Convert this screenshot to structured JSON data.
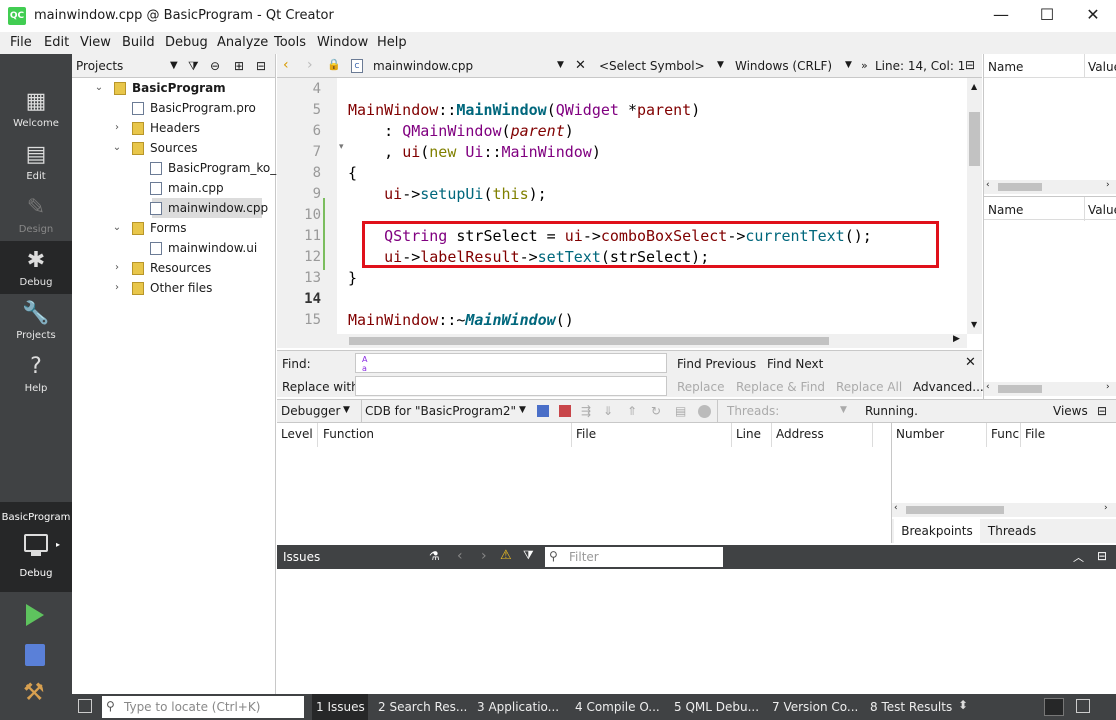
{
  "window": {
    "title": "mainwindow.cpp @ BasicProgram - Qt Creator",
    "app_icon": "QC",
    "minimize": "—",
    "maximize": "☐",
    "close": "✕"
  },
  "menu": [
    "File",
    "Edit",
    "View",
    "Build",
    "Debug",
    "Analyze",
    "Tools",
    "Window",
    "Help"
  ],
  "modes": [
    {
      "label": "Welcome",
      "icon": "▦"
    },
    {
      "label": "Edit",
      "icon": "▤"
    },
    {
      "label": "Design",
      "icon": "✎"
    },
    {
      "label": "Debug",
      "icon": "✱"
    },
    {
      "label": "Projects",
      "icon": "🔧"
    },
    {
      "label": "Help",
      "icon": "?"
    }
  ],
  "kit": {
    "project": "BasicProgram",
    "config": "Debug"
  },
  "projects_pane": {
    "title": "Projects",
    "tree": [
      {
        "label": "BasicProgram",
        "depth": 0,
        "arrow": "⌄",
        "bold": true
      },
      {
        "label": "BasicProgram.pro",
        "depth": 1,
        "arrow": ""
      },
      {
        "label": "Headers",
        "depth": 1,
        "arrow": "›"
      },
      {
        "label": "Sources",
        "depth": 1,
        "arrow": "⌄"
      },
      {
        "label": "BasicProgram_ko_KR.ts",
        "depth": 2,
        "arrow": ""
      },
      {
        "label": "main.cpp",
        "depth": 2,
        "arrow": ""
      },
      {
        "label": "mainwindow.cpp",
        "depth": 2,
        "arrow": "",
        "selected": true
      },
      {
        "label": "Forms",
        "depth": 1,
        "arrow": "⌄"
      },
      {
        "label": "mainwindow.ui",
        "depth": 2,
        "arrow": ""
      },
      {
        "label": "Resources",
        "depth": 1,
        "arrow": "›"
      },
      {
        "label": "Other files",
        "depth": 1,
        "arrow": "›"
      }
    ]
  },
  "editor": {
    "file": "mainwindow.cpp",
    "symbol": "<Select Symbol>",
    "encoding": "Windows (CRLF)",
    "position": "Line: 14, Col: 1",
    "lines": [
      "4",
      "5",
      "6",
      "7",
      "8",
      "9",
      "10",
      "11",
      "12",
      "13",
      "14",
      "15"
    ]
  },
  "find": {
    "find_label": "Find:",
    "replace_label": "Replace with:",
    "find_prev": "Find Previous",
    "find_next": "Find Next",
    "replace": "Replace",
    "replace_find": "Replace & Find",
    "replace_all": "Replace All",
    "advanced": "Advanced..."
  },
  "locals": {
    "name": "Name",
    "value": "Value"
  },
  "debugger": {
    "selector": "Debugger",
    "engine": "CDB for \"BasicProgram2\"",
    "threads": "Threads:",
    "status": "Running.",
    "views": "Views"
  },
  "stack_cols": [
    "Level",
    "Function",
    "File",
    "Line",
    "Address"
  ],
  "bp_cols": [
    "Number",
    "Func",
    "File"
  ],
  "bp_tabs": [
    "Breakpoints",
    "Threads"
  ],
  "issues": {
    "title": "Issues",
    "filter_placeholder": "Filter"
  },
  "status": {
    "locate_placeholder": "Type to locate (Ctrl+K)",
    "tabs": [
      "1  Issues",
      "2  Search Res...",
      "3  Applicatio...",
      "4  Compile O...",
      "5  QML Debu...",
      "7  Version Co...",
      "8  Test Results"
    ]
  },
  "colors": {
    "dark": "#404244",
    "highlight": "#e0101a",
    "pane": "#f0f0f0"
  }
}
